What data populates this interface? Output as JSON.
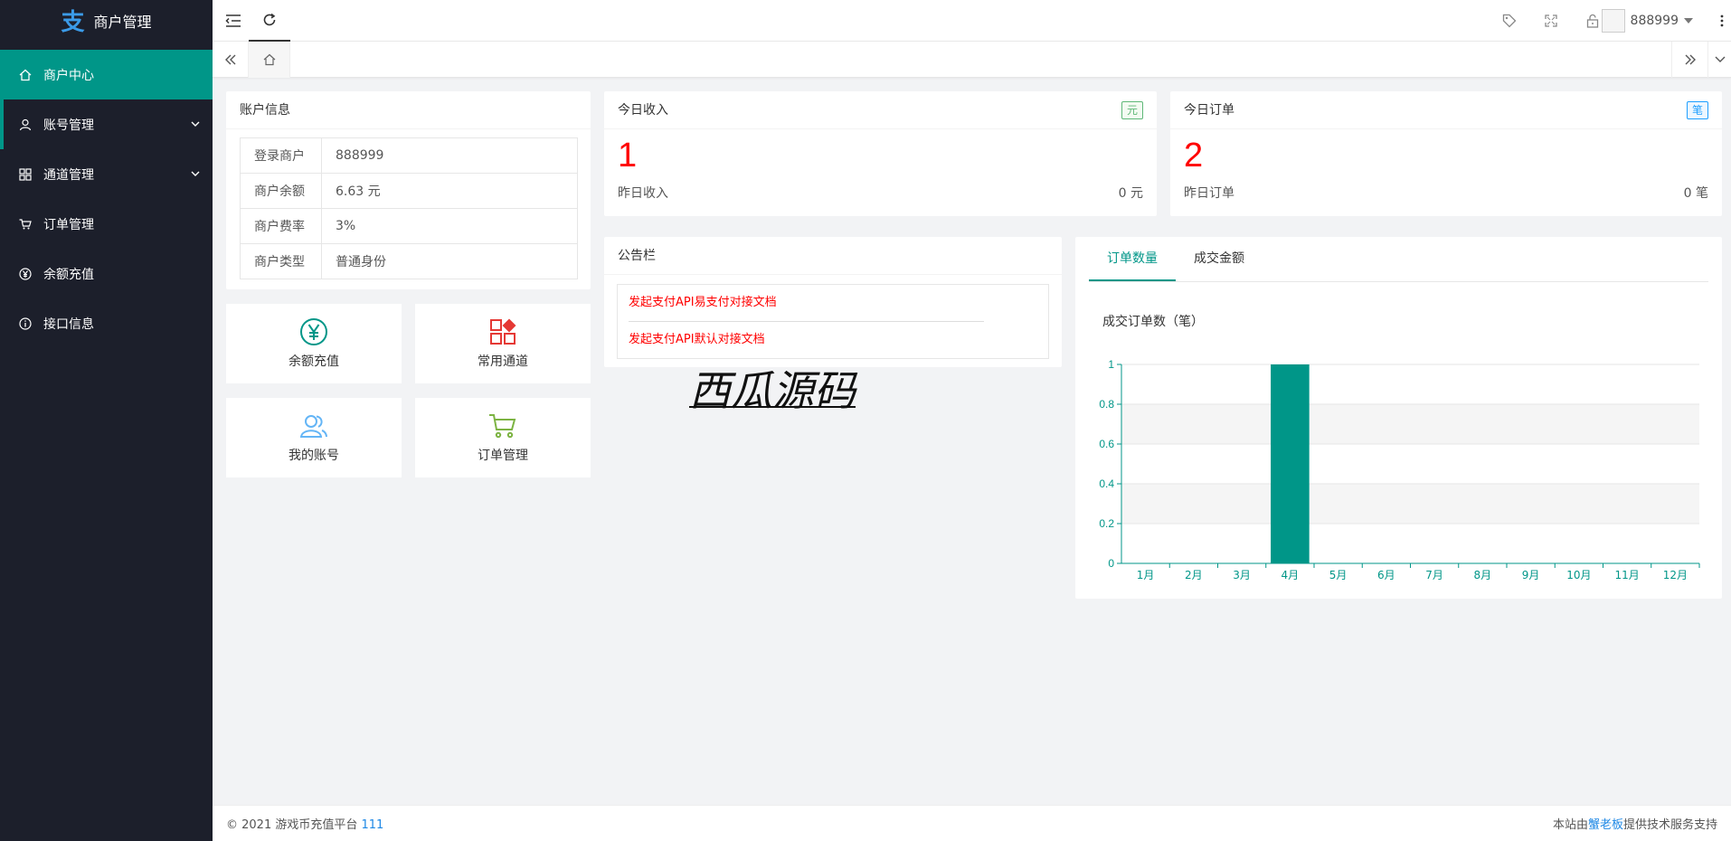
{
  "app": {
    "logo_glyph": "支",
    "title": "商户管理"
  },
  "sidebar": {
    "items": [
      {
        "label": "商户中心",
        "icon": "home-icon"
      },
      {
        "label": "账号管理",
        "icon": "user-icon"
      },
      {
        "label": "通道管理",
        "icon": "grid-icon"
      },
      {
        "label": "订单管理",
        "icon": "cart-icon"
      },
      {
        "label": "余额充值",
        "icon": "yen-icon"
      },
      {
        "label": "接口信息",
        "icon": "info-icon"
      }
    ]
  },
  "header": {
    "username": "888999"
  },
  "account": {
    "title": "账户信息",
    "rows": [
      {
        "key": "登录商户",
        "value": "888999"
      },
      {
        "key": "商户余额",
        "value": "6.63 元"
      },
      {
        "key": "商户费率",
        "value": "3%"
      },
      {
        "key": "商户类型",
        "value": "普通身份"
      }
    ]
  },
  "income": {
    "title": "今日收入",
    "badge": "元",
    "value": "1",
    "sub_label": "昨日收入",
    "sub_value": "0 元"
  },
  "orders": {
    "title": "今日订单",
    "badge": "笔",
    "value": "2",
    "sub_label": "昨日订单",
    "sub_value": "0 笔"
  },
  "shortcuts": [
    {
      "label": "余额充值",
      "icon": "yen-icon"
    },
    {
      "label": "常用通道",
      "icon": "apps-icon"
    },
    {
      "label": "我的账号",
      "icon": "users-icon"
    },
    {
      "label": "订单管理",
      "icon": "cart-icon"
    }
  ],
  "notice": {
    "title": "公告栏",
    "links": [
      "发起支付API易支付对接文档",
      "发起支付API默认对接文档"
    ]
  },
  "chart_panel": {
    "tabs": [
      "订单数量",
      "成交金额"
    ],
    "chart_title": "成交订单数（笔）"
  },
  "chart_data": {
    "type": "bar",
    "title": "成交订单数（笔）",
    "categories": [
      "1月",
      "2月",
      "3月",
      "4月",
      "5月",
      "6月",
      "7月",
      "8月",
      "9月",
      "10月",
      "11月",
      "12月"
    ],
    "values": [
      0,
      0,
      0,
      1,
      0,
      0,
      0,
      0,
      0,
      0,
      0,
      0
    ],
    "yticks": [
      "0",
      "0.2",
      "0.4",
      "0.6",
      "0.8",
      "1"
    ],
    "ylim": [
      0,
      1
    ],
    "grid": true,
    "bar_color": "#009688"
  },
  "watermark": "西瓜源码",
  "footer": {
    "copyright": "© 2021 游戏币充值平台",
    "version": "111",
    "support_prefix": "本站由",
    "support_name": "蟹老板",
    "support_suffix": "提供技术服务支持"
  },
  "colors": {
    "accent": "#009688",
    "sidebar_bg": "#1c1f2b",
    "red": "#ff0000"
  }
}
